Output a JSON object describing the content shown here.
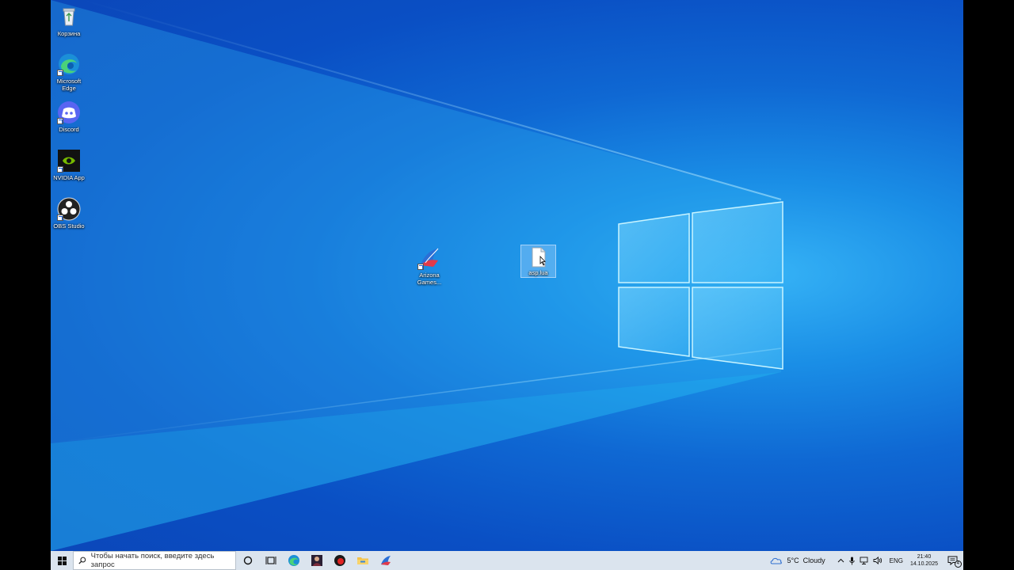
{
  "desktop": {
    "icons": [
      {
        "label": "Корзина",
        "icon": "recycle-bin-icon"
      },
      {
        "label": "Microsoft Edge",
        "icon": "edge-icon"
      },
      {
        "label": "Discord",
        "icon": "discord-icon"
      },
      {
        "label": "NVIDIA App",
        "icon": "nvidia-icon"
      },
      {
        "label": "OBS Studio",
        "icon": "obs-icon"
      },
      {
        "label": "Arizona Games...",
        "icon": "arizona-games-icon"
      },
      {
        "label": "asp.lua",
        "icon": "file-icon"
      }
    ]
  },
  "taskbar": {
    "search_placeholder": "Чтобы начать поиск, введите здесь запрос",
    "apps": [
      "cortana-icon",
      "task-view-icon",
      "edge-icon",
      "profile-app-icon",
      "red-app-icon",
      "file-explorer-icon",
      "arizona-games-icon"
    ],
    "weather": {
      "temp": "5°C",
      "condition": "Cloudy"
    },
    "language": "ENG",
    "time": "21:40",
    "date": "14.10.2025",
    "notification_count": "4"
  },
  "colors": {
    "taskbar_bg": "#dbe4ee",
    "desktop_blue": "#0f68d3"
  }
}
